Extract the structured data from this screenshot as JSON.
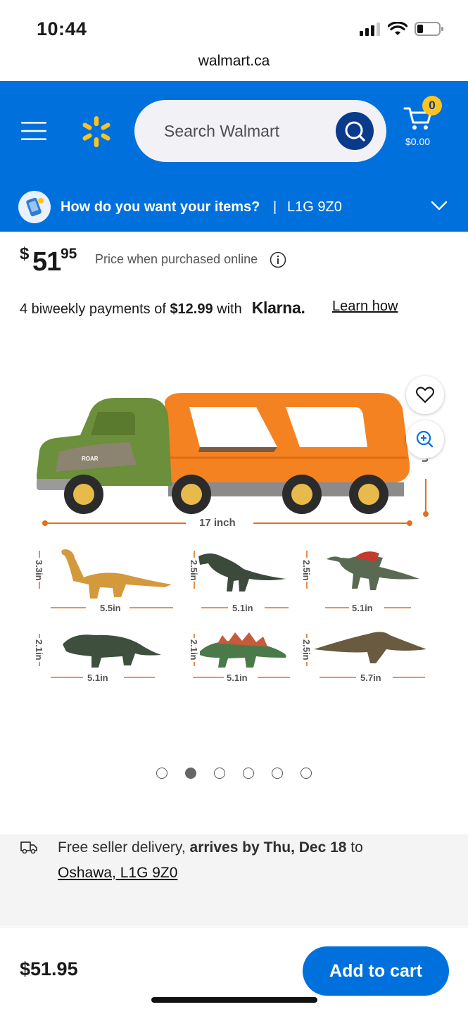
{
  "status_bar": {
    "time": "10:44"
  },
  "browser": {
    "url": "walmart.ca"
  },
  "header": {
    "search_placeholder": "Search Walmart",
    "cart_count": "0",
    "cart_total": "$0.00",
    "delivery_question": "How do you want your items?",
    "delivery_separator": "|",
    "postal_code": "L1G 9Z0"
  },
  "product": {
    "price_symbol": "$",
    "price_whole": "51",
    "price_cents": "95",
    "price_note": "Price when purchased online",
    "klarna": {
      "prefix": "4 biweekly payments of ",
      "amount": "$12.99",
      "suffix": " with",
      "brand": "Klarna.",
      "learn_how": "Learn how"
    },
    "image": {
      "truck_roar": "ROAR",
      "truck_length": "17 inch",
      "side_height": "nch",
      "dinos": [
        {
          "height": "3.3in",
          "length": "5.5in"
        },
        {
          "height": "2.5in",
          "length": "5.1in"
        },
        {
          "height": "2.5in",
          "length": "5.1in"
        },
        {
          "height": "2.1in",
          "length": "5.1in"
        },
        {
          "height": "2.1in",
          "length": "5.1in"
        },
        {
          "height": "2.5in",
          "length": "5.7in"
        }
      ]
    },
    "carousel": {
      "count": 6,
      "active_index": 1
    }
  },
  "shipping": {
    "prefix": "Free seller delivery, ",
    "bold": "arrives by Thu, Dec 18",
    "suffix": " to",
    "address": "Oshawa, L1G 9Z0"
  },
  "bottom": {
    "price": "$51.95",
    "add_to_cart": "Add to cart"
  },
  "colors": {
    "brand_blue": "#0071dc",
    "spark_yellow": "#ffc220",
    "dark_blue": "#0a3a8c"
  }
}
